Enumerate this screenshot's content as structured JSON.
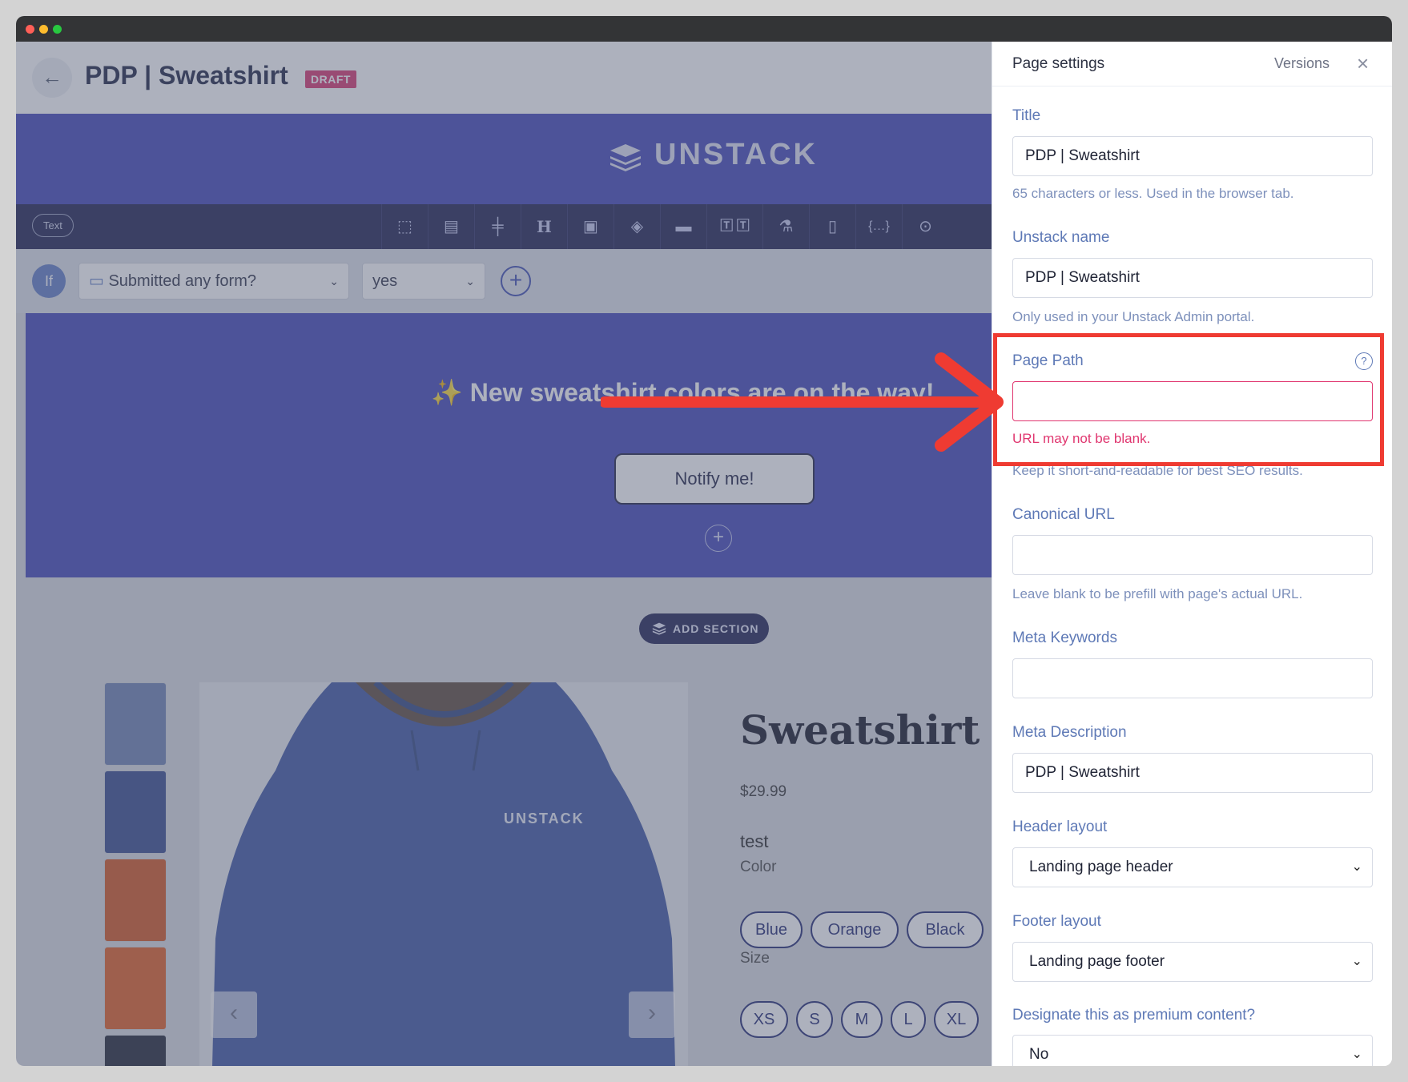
{
  "window": {
    "dots": [
      "#ff5f57",
      "#febc2e",
      "#28c840"
    ]
  },
  "editor": {
    "back_icon": "arrow-left-icon",
    "page_title": "PDP | Sweatshirt",
    "status_badge": "DRAFT",
    "brand_name": "UNSTACK",
    "toolbar": {
      "mode_label": "Text",
      "tools": [
        "select-icon",
        "section-icon",
        "align-icon",
        "heading-icon",
        "image-icon",
        "fill-icon",
        "width-icon",
        "text-style-icon",
        "flask-icon",
        "layout-icon",
        "code-icon",
        "target-icon"
      ]
    },
    "condition": {
      "if_label": "If",
      "field_value": "Submitted any form?",
      "answer_value": "yes"
    },
    "banner": {
      "headline": "✨ New sweatshirt colors are on the way!",
      "button_label": "Notify me!"
    },
    "add_section_label": "ADD SECTION",
    "product": {
      "title": "Sweatshirt",
      "price": "$29.99",
      "test_label": "test",
      "color_label": "Color",
      "colors": [
        "Blue",
        "Orange",
        "Black"
      ],
      "size_label": "Size",
      "sizes": [
        "XS",
        "S",
        "M",
        "L",
        "XL"
      ],
      "image_brand": "UNSTACK",
      "thumbnail_colors": [
        "#6b7fb0",
        "#33468a",
        "#d2531d",
        "#e05a1f",
        "#1d2030"
      ]
    }
  },
  "panel": {
    "title": "Page settings",
    "versions_label": "Versions",
    "close_icon": "close-icon",
    "fields": {
      "title": {
        "label": "Title",
        "value": "PDP | Sweatshirt",
        "help": "65 characters or less. Used in the browser tab."
      },
      "unstack_name": {
        "label": "Unstack name",
        "value": "PDP | Sweatshirt",
        "help": "Only used in your Unstack Admin portal."
      },
      "page_path": {
        "label": "Page Path",
        "value": "",
        "error": "URL may not be blank.",
        "help": "Keep it short-and-readable for best SEO results.",
        "help_icon": "?"
      },
      "canonical_url": {
        "label": "Canonical URL",
        "value": "",
        "help": "Leave blank to be prefill with page's actual URL."
      },
      "meta_keywords": {
        "label": "Meta Keywords",
        "value": ""
      },
      "meta_description": {
        "label": "Meta Description",
        "value": "PDP | Sweatshirt"
      },
      "header_layout": {
        "label": "Header layout",
        "value": "Landing page header"
      },
      "footer_layout": {
        "label": "Footer layout",
        "value": "Landing page footer"
      },
      "premium": {
        "label": "Designate this as premium content?",
        "value": "No"
      }
    }
  },
  "colors": {
    "accent": "#3f43b6",
    "error": "#e0366f",
    "annotation": "#ef3b32",
    "label": "#5e79b6"
  }
}
